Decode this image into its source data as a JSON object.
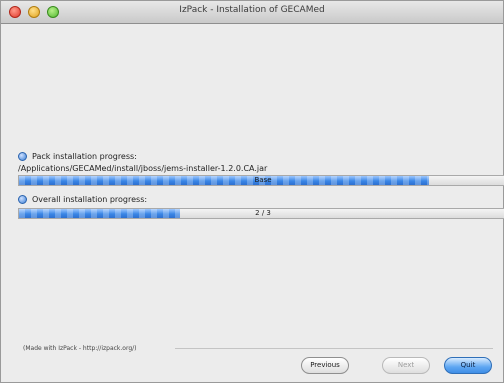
{
  "window": {
    "title": "IzPack - Installation of GECAMed"
  },
  "main": {
    "pack_progress_label": "Pack installation progress:",
    "pack_path": "/Applications/GECAMed/install/jboss/jems-installer-1.2.0.CA.jar",
    "pack_bar_text": "Base",
    "pack_progress_fraction": 0.84,
    "overall_progress_label": "Overall installation progress:",
    "overall_bar_text": "2 / 3",
    "overall_progress_fraction": 0.33
  },
  "footer": {
    "made_with": "(Made with IzPack - http://izpack.org/)"
  },
  "buttons": {
    "previous": "Previous",
    "next": "Next",
    "quit": "Quit"
  },
  "colors": {
    "progress_blue": "#3a86e6"
  }
}
